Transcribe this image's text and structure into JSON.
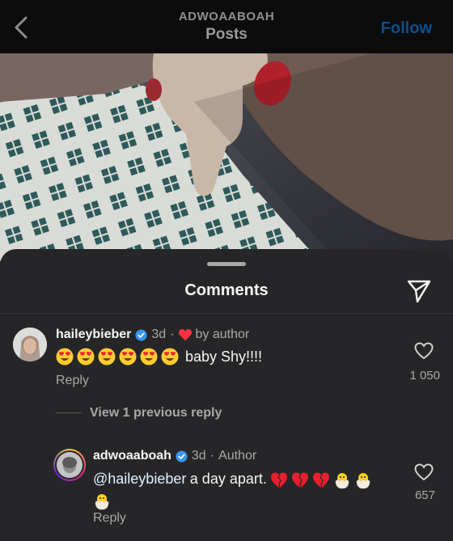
{
  "header": {
    "username": "ADWOAABOAH",
    "title": "Posts",
    "follow_label": "Follow",
    "follow_color": "#0b4f8a"
  },
  "icons": {
    "back": "chevron-left-icon",
    "share": "paper-plane-icon",
    "like": "heart-outline-icon",
    "verified": "verified-badge-icon"
  },
  "comments_sheet": {
    "title": "Comments",
    "comments": [
      {
        "username": "haileybieber",
        "verified": true,
        "time": "3d",
        "separator": "·",
        "liked_by_author": "by author",
        "emoji_prefix": [
          "heart-eyes",
          "heart-eyes",
          "heart-eyes",
          "heart-eyes",
          "heart-eyes",
          "heart-eyes"
        ],
        "text": "baby Shy!!!!",
        "reply_label": "Reply",
        "like_count": "1 050"
      }
    ],
    "view_replies_label": "View 1 previous reply",
    "replies": [
      {
        "username": "adwoaaboah",
        "verified": true,
        "time": "3d",
        "separator": "·",
        "badge": "Author",
        "mention": "@haileybieber",
        "text": "a day apart.",
        "emoji_suffix": [
          "broken-heart",
          "broken-heart",
          "broken-heart",
          "hatching-chick",
          "hatching-chick",
          "hatching-chick"
        ],
        "reply_label": "Reply",
        "like_count": "657"
      }
    ]
  },
  "colors": {
    "verified": "#3797f0",
    "heart_red": "#ff3040",
    "sheet_bg": "#262628"
  }
}
